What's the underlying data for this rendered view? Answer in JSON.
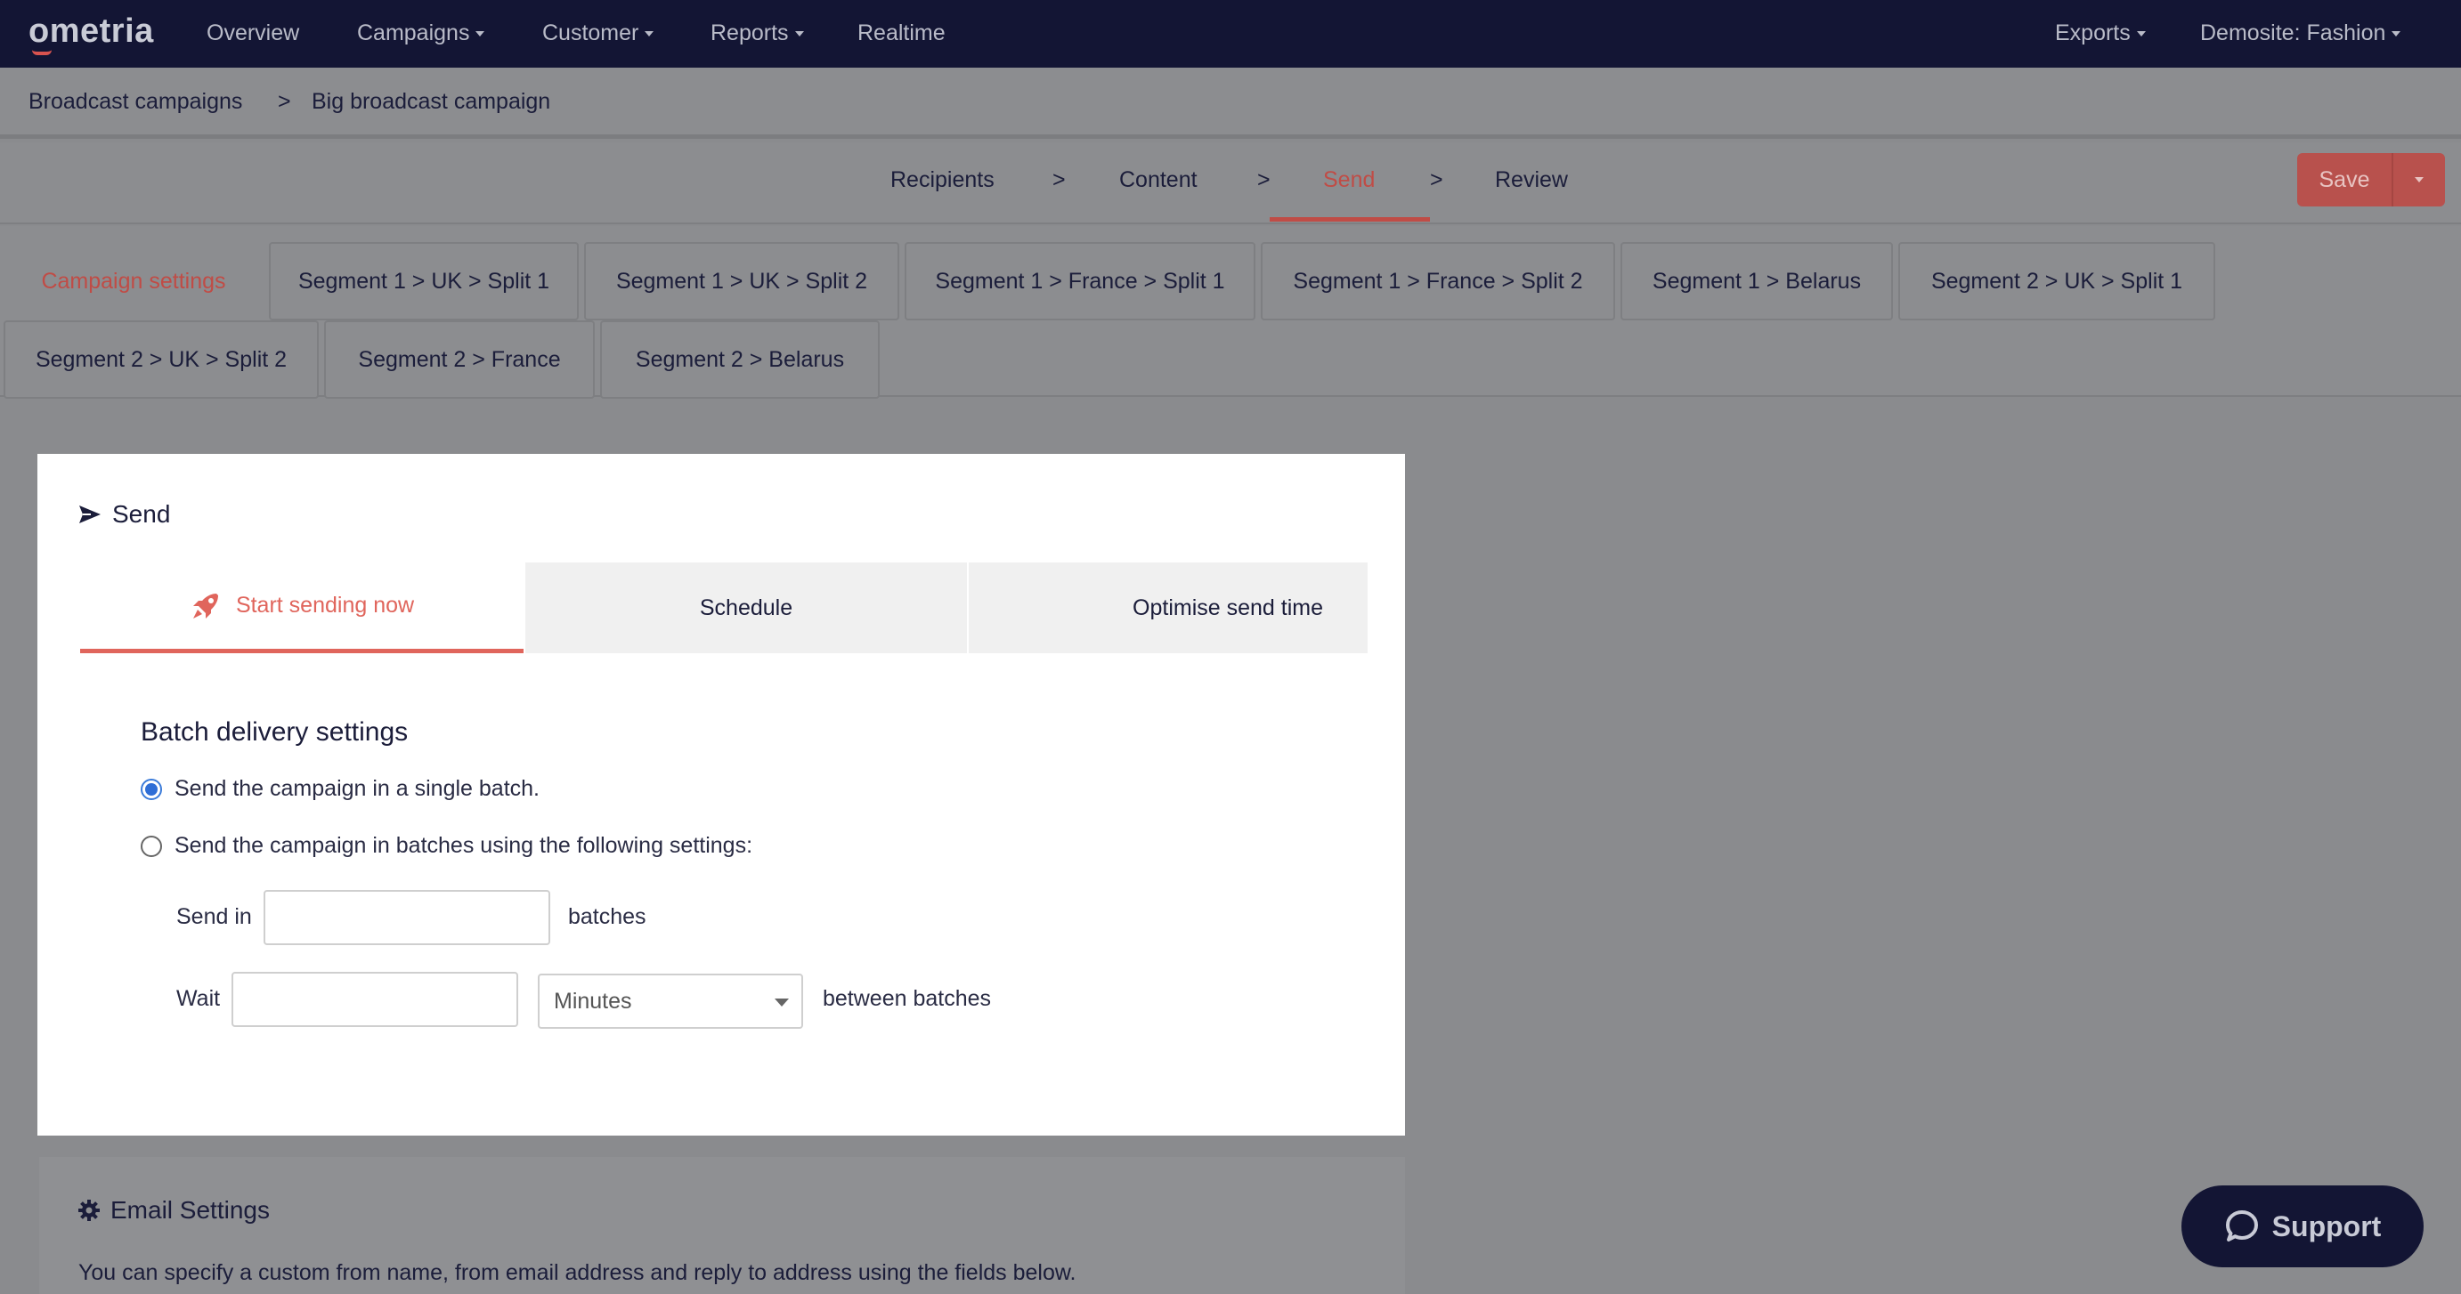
{
  "app": {
    "logo_text": "ometria",
    "nav": [
      "Overview",
      "Campaigns",
      "Customer",
      "Reports",
      "Realtime"
    ],
    "exports_label": "Exports",
    "site_label": "Demosite: Fashion"
  },
  "breadcrumb": {
    "root": "Broadcast campaigns",
    "separator": ">",
    "current": "Big broadcast campaign"
  },
  "steps": {
    "items": [
      "Recipients",
      "Content",
      "Send",
      "Review"
    ],
    "separator": ">",
    "active": "Send",
    "save_label": "Save"
  },
  "segment_tabs": [
    "Campaign settings",
    "Segment 1 > UK > Split 1",
    "Segment 1 > UK > Split 2",
    "Segment 1 > France > Split 1",
    "Segment 1 > France > Split 2",
    "Segment 1 > Belarus",
    "Segment 2 > UK > Split 1",
    "Segment 2 > UK > Split 2",
    "Segment 2 > France",
    "Segment 2 > Belarus"
  ],
  "send_panel": {
    "title": "Send",
    "mode_tabs": [
      "Start sending now",
      "Schedule",
      "Optimise send time"
    ],
    "active_mode": "Start sending now",
    "batch_title": "Batch delivery settings",
    "option_single": "Send the campaign in a single batch.",
    "option_batches": "Send the campaign in batches using the following settings:",
    "selected_option": "single",
    "send_in_label": "Send in",
    "send_in_value": "",
    "batches_label": "batches",
    "wait_label": "Wait",
    "wait_value": "",
    "wait_unit": "Minutes",
    "between_label": "between batches"
  },
  "email_settings": {
    "title": "Email Settings",
    "description": "You can specify a custom from name, from email address and reply to address using the fields below."
  },
  "support": {
    "label": "Support"
  },
  "colors": {
    "nav_bg": "#131534",
    "accent": "#e0655c",
    "save_bg": "#b8514d",
    "radio": "#2f6ed6"
  }
}
